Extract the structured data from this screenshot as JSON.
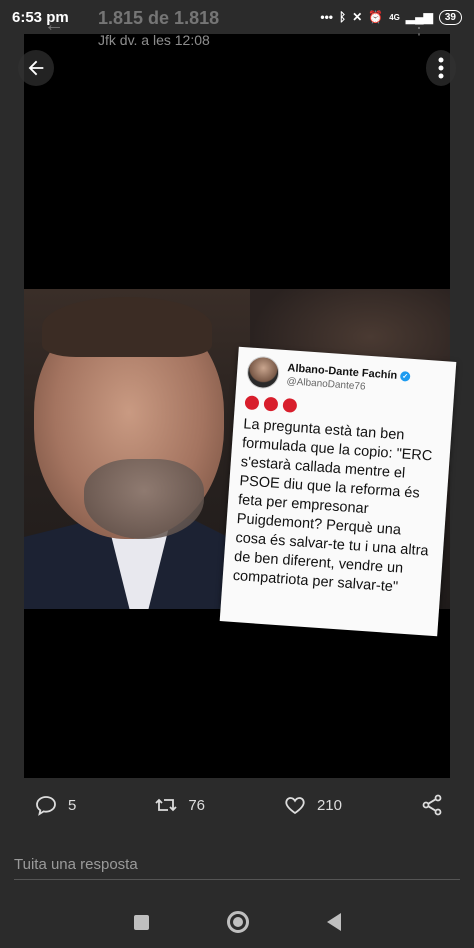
{
  "status_bar": {
    "time": "6:53 pm",
    "icons": [
      "dots-icon",
      "bluetooth-icon",
      "mute-icon",
      "alarm-icon",
      "signal-icon",
      "battery-icon"
    ],
    "network": "4G",
    "battery": "39"
  },
  "header": {
    "counter": "1.815 de 1.818",
    "subtitle": "Jfk dv. a les 12:08"
  },
  "tweet_card": {
    "name": "Albano-Dante Fachín",
    "handle": "@AlbanoDante76",
    "text": "La pregunta està tan ben formulada que la copio: \"ERC s'estarà callada mentre el PSOE diu que la reforma és feta per empresonar Puigdemont? Perquè una cosa és salvar-te tu i una altra de ben diferent, vendre un compatriota per salvar-te\""
  },
  "actions": {
    "replies": "5",
    "retweets": "76",
    "likes": "210"
  },
  "reply": {
    "placeholder": "Tuita una resposta"
  },
  "colors": {
    "background": "#2b2b2b",
    "viewer": "#000000",
    "accent_red": "#d81e2c",
    "verified_blue": "#1d9bf0"
  }
}
